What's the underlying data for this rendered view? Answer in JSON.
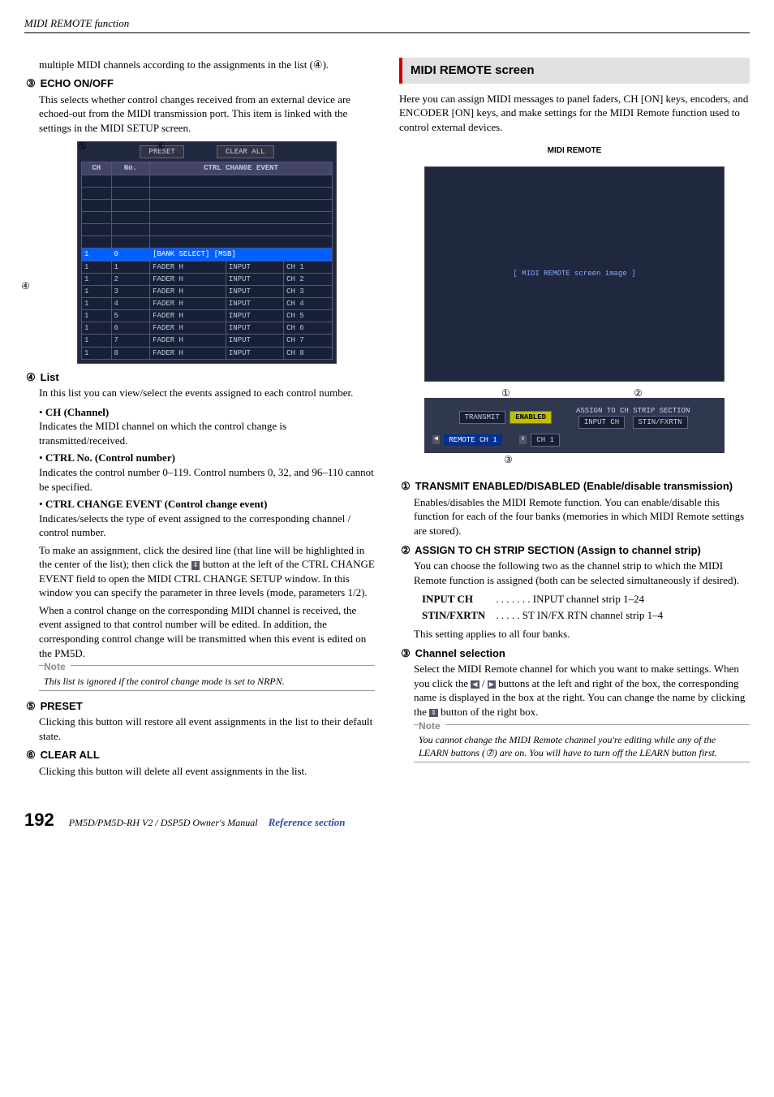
{
  "header": {
    "title": "MIDI REMOTE function"
  },
  "left": {
    "intro": "multiple MIDI channels according to the assignments in the list (④).",
    "echo": {
      "num": "③",
      "title": "ECHO ON/OFF",
      "body": "This selects whether control changes received from an external device are echoed-out from the MIDI transmission port. This item is linked with the settings in the MIDI SETUP screen."
    },
    "callouts": {
      "c4": "④",
      "c5": "⑤",
      "c6": "⑥"
    },
    "table": {
      "preset_btn": "PRESET",
      "clear_btn": "CLEAR ALL",
      "headers": [
        "CH",
        "No.",
        "CTRL CHANGE EVENT"
      ],
      "selected": [
        "1",
        "0",
        "[BANK SELECT] [MSB]"
      ],
      "rows": [
        [
          "1",
          "1",
          "FADER H",
          "INPUT",
          "CH 1"
        ],
        [
          "1",
          "2",
          "FADER H",
          "INPUT",
          "CH 2"
        ],
        [
          "1",
          "3",
          "FADER H",
          "INPUT",
          "CH 3"
        ],
        [
          "1",
          "4",
          "FADER H",
          "INPUT",
          "CH 4"
        ],
        [
          "1",
          "5",
          "FADER H",
          "INPUT",
          "CH 5"
        ],
        [
          "1",
          "6",
          "FADER H",
          "INPUT",
          "CH 6"
        ],
        [
          "1",
          "7",
          "FADER H",
          "INPUT",
          "CH 7"
        ],
        [
          "1",
          "8",
          "FADER H",
          "INPUT",
          "CH 8"
        ]
      ]
    },
    "list": {
      "num": "④",
      "title": "List",
      "body": "In this list you can view/select the events assigned to each control number.",
      "ch_head": "CH (Channel)",
      "ch_body": "Indicates the MIDI channel on which the control change is transmitted/received.",
      "ctrlno_head": "CTRL No. (Control number)",
      "ctrlno_body": "Indicates the control number 0–119. Control numbers 0, 32, and 96–110 cannot be specified.",
      "ccevt_head": "CTRL CHANGE EVENT (Control change event)",
      "ccevt_body1": "Indicates/selects the type of event assigned to the corresponding channel / control number.",
      "ccevt_body2": "To make an assignment, click the desired line (that line will be highlighted in the center of the list); then click the ",
      "ccevt_body2b": " button at the left of the CTRL CHANGE EVENT field to open the MIDI CTRL CHANGE SETUP window. In this window you can specify the parameter in three levels (mode, parameters 1/2).",
      "ccevt_body3": "When a control change on the corresponding MIDI channel is received, the event assigned to that control number will be edited. In addition, the corresponding control change will be transmitted when this event is edited on the PM5D."
    },
    "note1": {
      "label": "Note",
      "text": "This list is ignored if the control change mode is set to NRPN."
    },
    "preset": {
      "num": "⑤",
      "title": "PRESET",
      "body": "Clicking this button will restore all event assignments in the list to their default state."
    },
    "clearall": {
      "num": "⑥",
      "title": "CLEAR ALL",
      "body": "Clicking this button will delete all event assignments in the list."
    }
  },
  "right": {
    "screen_title": "MIDI REMOTE screen",
    "intro": "Here you can assign MIDI messages to panel faders, CH [ON] keys, encoders, and ENCODER [ON] keys, and make settings for the MIDI Remote function used to control external devices.",
    "screenshot_label": "MIDI REMOTE",
    "panel": {
      "transmit": "TRANSMIT",
      "enabled": "ENABLED",
      "assign_label": "ASSIGN TO CH STRIP SECTION",
      "input_ch_btn": "INPUT CH",
      "stin_btn": "STIN/FXRTN",
      "remote_ch": "REMOTE CH 1",
      "ch_box": "CH 1",
      "c1": "①",
      "c2": "②",
      "c3": "③"
    },
    "item1": {
      "num": "①",
      "title": "TRANSMIT ENABLED/DISABLED (Enable/disable transmission)",
      "body": "Enables/disables the MIDI Remote function. You can enable/disable this function for each of the four banks (memories in which MIDI Remote settings are stored)."
    },
    "item2": {
      "num": "②",
      "title": "ASSIGN TO CH STRIP SECTION (Assign to channel strip)",
      "body": "You can choose the following two as the channel strip to which the MIDI Remote function is assigned (both can be selected simultaneously if desired).",
      "def1_term": "INPUT CH",
      "def1_dots": " . . . . . . . ",
      "def1_val": "INPUT channel strip 1–24",
      "def2_term": "STIN/FXRTN",
      "def2_dots": " . . . . . ",
      "def2_val": "ST IN/FX RTN channel strip 1–4",
      "tail": "This setting applies to all four banks."
    },
    "item3": {
      "num": "③",
      "title": "Channel selection",
      "body_a": "Select the MIDI Remote channel for which you want to make settings. When you click the ",
      "body_b": " buttons at the left and right of the box, the corresponding name is displayed in the box at the right. You can change the name by clicking the ",
      "body_c": " button of the right box."
    },
    "note2": {
      "label": "Note",
      "text": "You cannot change the MIDI Remote channel you're editing while any of the LEARN buttons (⑦) are on. You will have to turn off the LEARN button first."
    }
  },
  "footer": {
    "page": "192",
    "manual": "PM5D/PM5D-RH V2 / DSP5D Owner's Manual",
    "section": "Reference section"
  }
}
